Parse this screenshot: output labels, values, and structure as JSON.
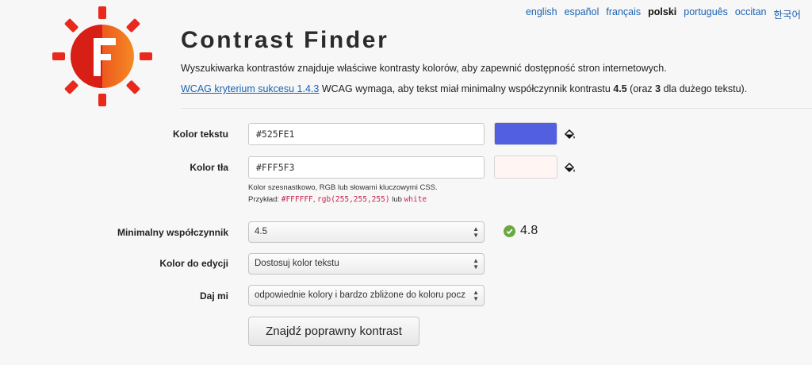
{
  "languages": [
    {
      "label": "english",
      "active": false
    },
    {
      "label": "español",
      "active": false
    },
    {
      "label": "français",
      "active": false
    },
    {
      "label": "polski",
      "active": true
    },
    {
      "label": "português",
      "active": false
    },
    {
      "label": "occitan",
      "active": false
    },
    {
      "label": "한국어",
      "active": false
    }
  ],
  "header": {
    "title": "Contrast Finder",
    "description": "Wyszukiwarka kontrastów znajduje właściwe kontrasty kolorów, aby zapewnić dostępność stron internetowych.",
    "wcag_link": "WCAG kryterium sukcesu 1.4.3",
    "wcag_text_1": " WCAG wymaga, aby tekst miał minimalny współczynnik kontrastu ",
    "wcag_ratio": "4.5",
    "wcag_text_2": " (oraz ",
    "wcag_large": "3",
    "wcag_text_3": " dla dużego tekstu)."
  },
  "form": {
    "text_color": {
      "label": "Kolor tekstu",
      "value": "#525FE1",
      "swatch": "#525FE1",
      "icon": "paint-bucket-icon"
    },
    "bg_color": {
      "label": "Kolor tła",
      "value": "#FFF5F3",
      "swatch": "#FFF5F3",
      "icon": "paint-bucket-icon"
    },
    "hint": {
      "line1": "Kolor szesnastkowo, RGB lub słowami kluczowymi CSS.",
      "prefix": "Przykład: ",
      "ex1": "#FFFFFF",
      "sep1": ", ",
      "ex2": "rgb(255,255,255)",
      "sep2": " lub ",
      "ex3": "white"
    },
    "min_ratio": {
      "label": "Minimalny współczynnik",
      "value": "4.5"
    },
    "current_ratio": {
      "value": "4.8",
      "icon": "check-circle-icon",
      "color": "#6aa842"
    },
    "edit_color": {
      "label": "Kolor do edycji",
      "value": "Dostosuj kolor tekstu"
    },
    "give_me": {
      "label": "Daj mi",
      "value": "odpowiednie kolory i bardzo zbliżone do koloru pocz"
    },
    "submit": "Znajdź poprawny kontrast"
  },
  "colors": {
    "link": "#1a62b3",
    "logo_red": "#e8291c",
    "logo_orange": "#f06a1e"
  }
}
